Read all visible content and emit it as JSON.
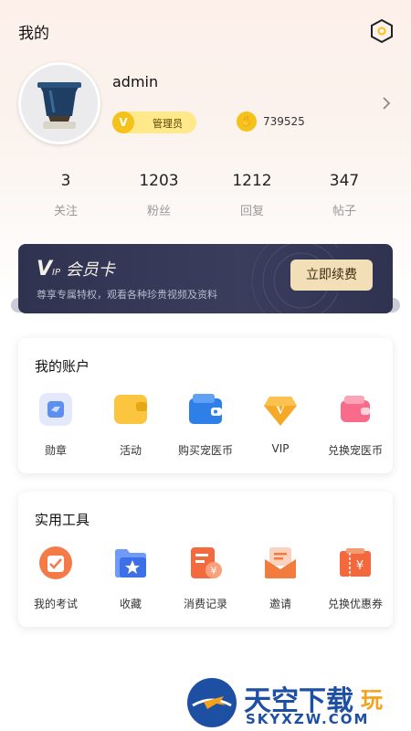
{
  "header": {
    "title": "我的"
  },
  "profile": {
    "username": "admin",
    "role": "管理员",
    "points": "739525"
  },
  "stats": [
    {
      "value": "3",
      "label": "关注"
    },
    {
      "value": "1203",
      "label": "粉丝"
    },
    {
      "value": "1212",
      "label": "回复"
    },
    {
      "value": "347",
      "label": "帖子"
    }
  ],
  "vip": {
    "title": "会员卡",
    "subtitle": "尊享专属特权，观看各种珍贵视频及资料",
    "button": "立即续费"
  },
  "account": {
    "title": "我的账户",
    "items": [
      {
        "label": "勋章",
        "icon": "medal-icon"
      },
      {
        "label": "活动",
        "icon": "activity-icon"
      },
      {
        "label": "购买宠医币",
        "icon": "wallet-icon"
      },
      {
        "label": "VIP",
        "icon": "vip-diamond-icon"
      },
      {
        "label": "兑换宠医币",
        "icon": "exchange-wallet-icon"
      }
    ]
  },
  "tools": {
    "title": "实用工具",
    "items": [
      {
        "label": "我的考试",
        "icon": "exam-icon"
      },
      {
        "label": "收藏",
        "icon": "favorite-folder-icon"
      },
      {
        "label": "消费记录",
        "icon": "consumption-record-icon"
      },
      {
        "label": "邀请",
        "icon": "invite-icon"
      },
      {
        "label": "兑换优惠券",
        "icon": "coupon-icon"
      }
    ]
  },
  "watermark": {
    "name": "天空下载",
    "name_suffix": "玩",
    "domain": "SKYXZW.COM"
  },
  "colors": {
    "accent_gold": "#f5c21b",
    "vip_card": "#2f3350",
    "renew_button": "#f3dfb7"
  }
}
